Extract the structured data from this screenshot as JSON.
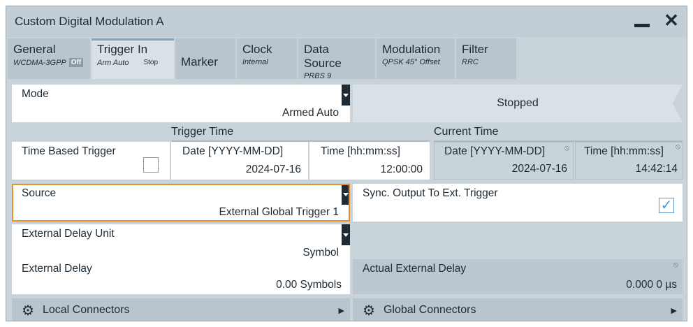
{
  "window": {
    "title": "Custom Digital Modulation A",
    "minimize_icon": "minimize-icon",
    "close_glyph": "✕"
  },
  "tabs": [
    {
      "label": "General",
      "sub": "WCDMA-3GPP",
      "badge": "Off"
    },
    {
      "label": "Trigger In",
      "sub": "Arm Auto",
      "badge": "Stop"
    },
    {
      "label": "Marker",
      "sub": "",
      "badge": ""
    },
    {
      "label": "Clock",
      "sub": "Internal",
      "badge": ""
    },
    {
      "label": "Data Source",
      "sub": "PRBS 9",
      "badge": ""
    },
    {
      "label": "Modulation",
      "sub": "QPSK 45° Offset",
      "badge": ""
    },
    {
      "label": "Filter",
      "sub": "RRC",
      "badge": ""
    }
  ],
  "mode": {
    "label": "Mode",
    "value": "Armed Auto",
    "status": "Stopped"
  },
  "trigger_time": {
    "header": "Trigger Time",
    "time_based_label": "Time Based Trigger",
    "date_label": "Date [YYYY-MM-DD]",
    "date_value": "2024-07-16",
    "time_label": "Time [hh:mm:ss]",
    "time_value": "12:00:00",
    "time_based_checked": false
  },
  "current_time": {
    "header": "Current Time",
    "date_label": "Date [YYYY-MM-DD]",
    "date_value": "2024-07-16",
    "time_label": "Time [hh:mm:ss]",
    "time_value": "14:42:14"
  },
  "source": {
    "label": "Source",
    "value": "External Global Trigger 1"
  },
  "sync_output": {
    "label": "Sync. Output To Ext. Trigger",
    "checked": true,
    "check_glyph": "✓"
  },
  "ext_delay_unit": {
    "label": "External Delay Unit",
    "value": "Symbol"
  },
  "ext_delay": {
    "label": "External Delay",
    "value": "0.00 Symbols"
  },
  "actual_ext_delay": {
    "label": "Actual External Delay",
    "value": "0.000 0 µs"
  },
  "connectors": {
    "local": {
      "label": "Local Connectors",
      "icon": "gear-icon",
      "glyph": "⚙",
      "arrow": "▶"
    },
    "global": {
      "label": "Global Connectors",
      "icon": "globe-gear-icon",
      "glyph": "⚙",
      "arrow": "▶"
    }
  },
  "readonly_glyph": "⦸"
}
